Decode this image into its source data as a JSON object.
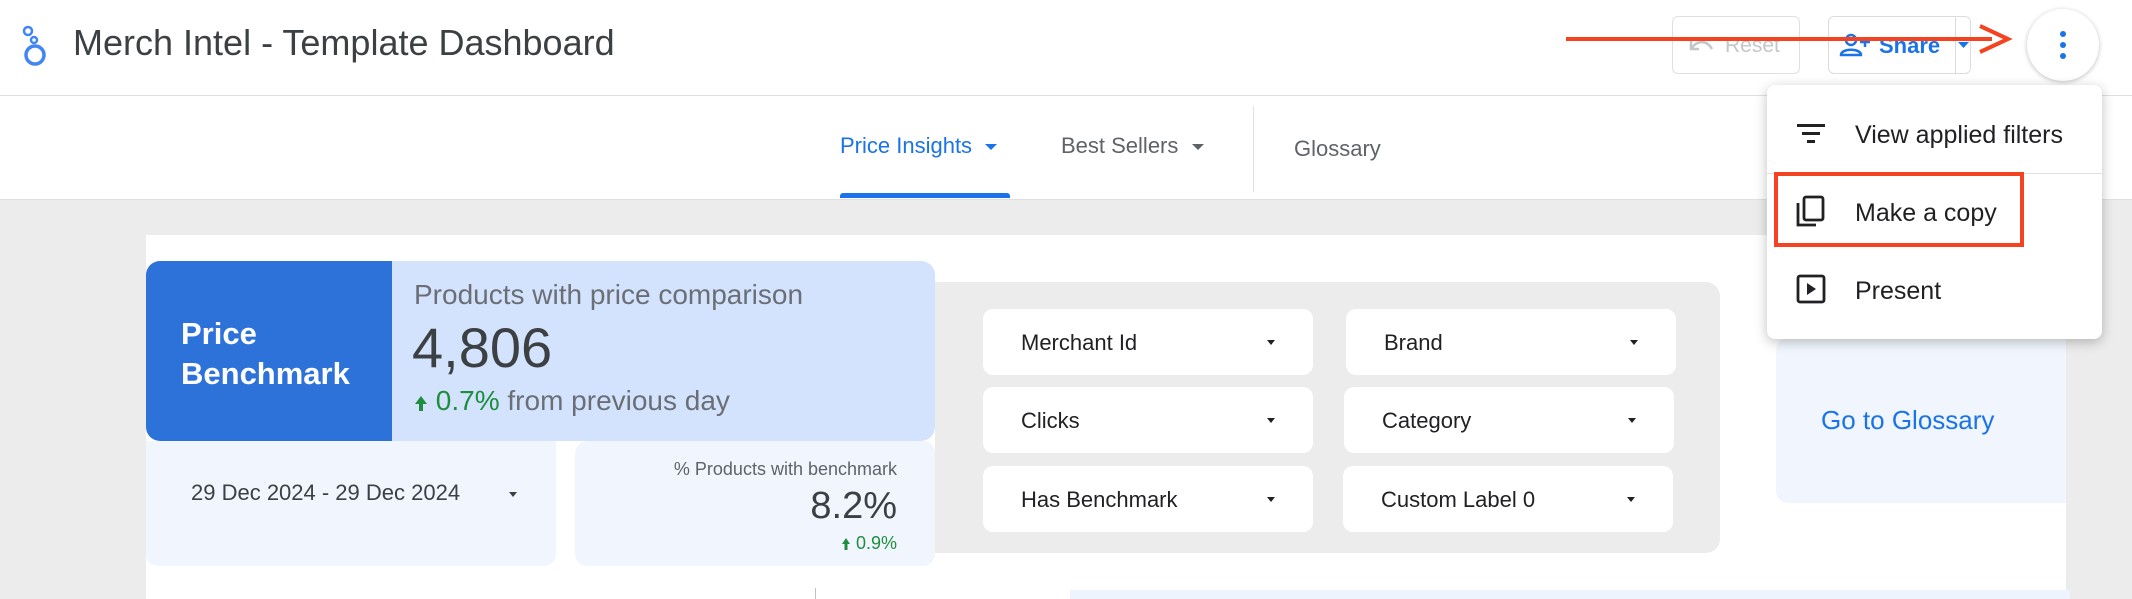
{
  "header": {
    "title": "Merch Intel - Template Dashboard",
    "reset_label": "Reset",
    "share_label": "Share"
  },
  "nav": {
    "tabs": [
      {
        "label": "Price Insights",
        "active": true
      },
      {
        "label": "Best Sellers",
        "active": false
      },
      {
        "label": "Glossary",
        "active": false
      }
    ]
  },
  "dashboard": {
    "price_benchmark": {
      "line1": "Price",
      "line2": "Benchmark"
    },
    "kpi": {
      "title": "Products with price comparison",
      "value": "4,806",
      "delta": "0.7%",
      "delta_suffix": "from previous day"
    },
    "date_range": "29 Dec 2024 - 29 Dec 2024",
    "benchmark": {
      "title": "% Products with benchmark",
      "value": "8.2%",
      "delta": "0.9%"
    },
    "filters": [
      "Merchant Id",
      "Brand",
      "Clicks",
      "Category",
      "Has Benchmark",
      "Custom Label 0"
    ],
    "glossary_link": "Go to Glossary"
  },
  "menu": {
    "items": [
      {
        "label": "View applied filters",
        "icon": "filter-list-icon"
      },
      {
        "label": "Make a copy",
        "icon": "copy-icon",
        "highlighted": true
      },
      {
        "label": "Present",
        "icon": "present-icon"
      }
    ]
  },
  "colors": {
    "accent": "#1a73e8",
    "benchmark_card": "#2d72d9",
    "kpi_card": "#d3e3fd",
    "positive": "#1e8e3e",
    "annotation": "#f44321"
  }
}
